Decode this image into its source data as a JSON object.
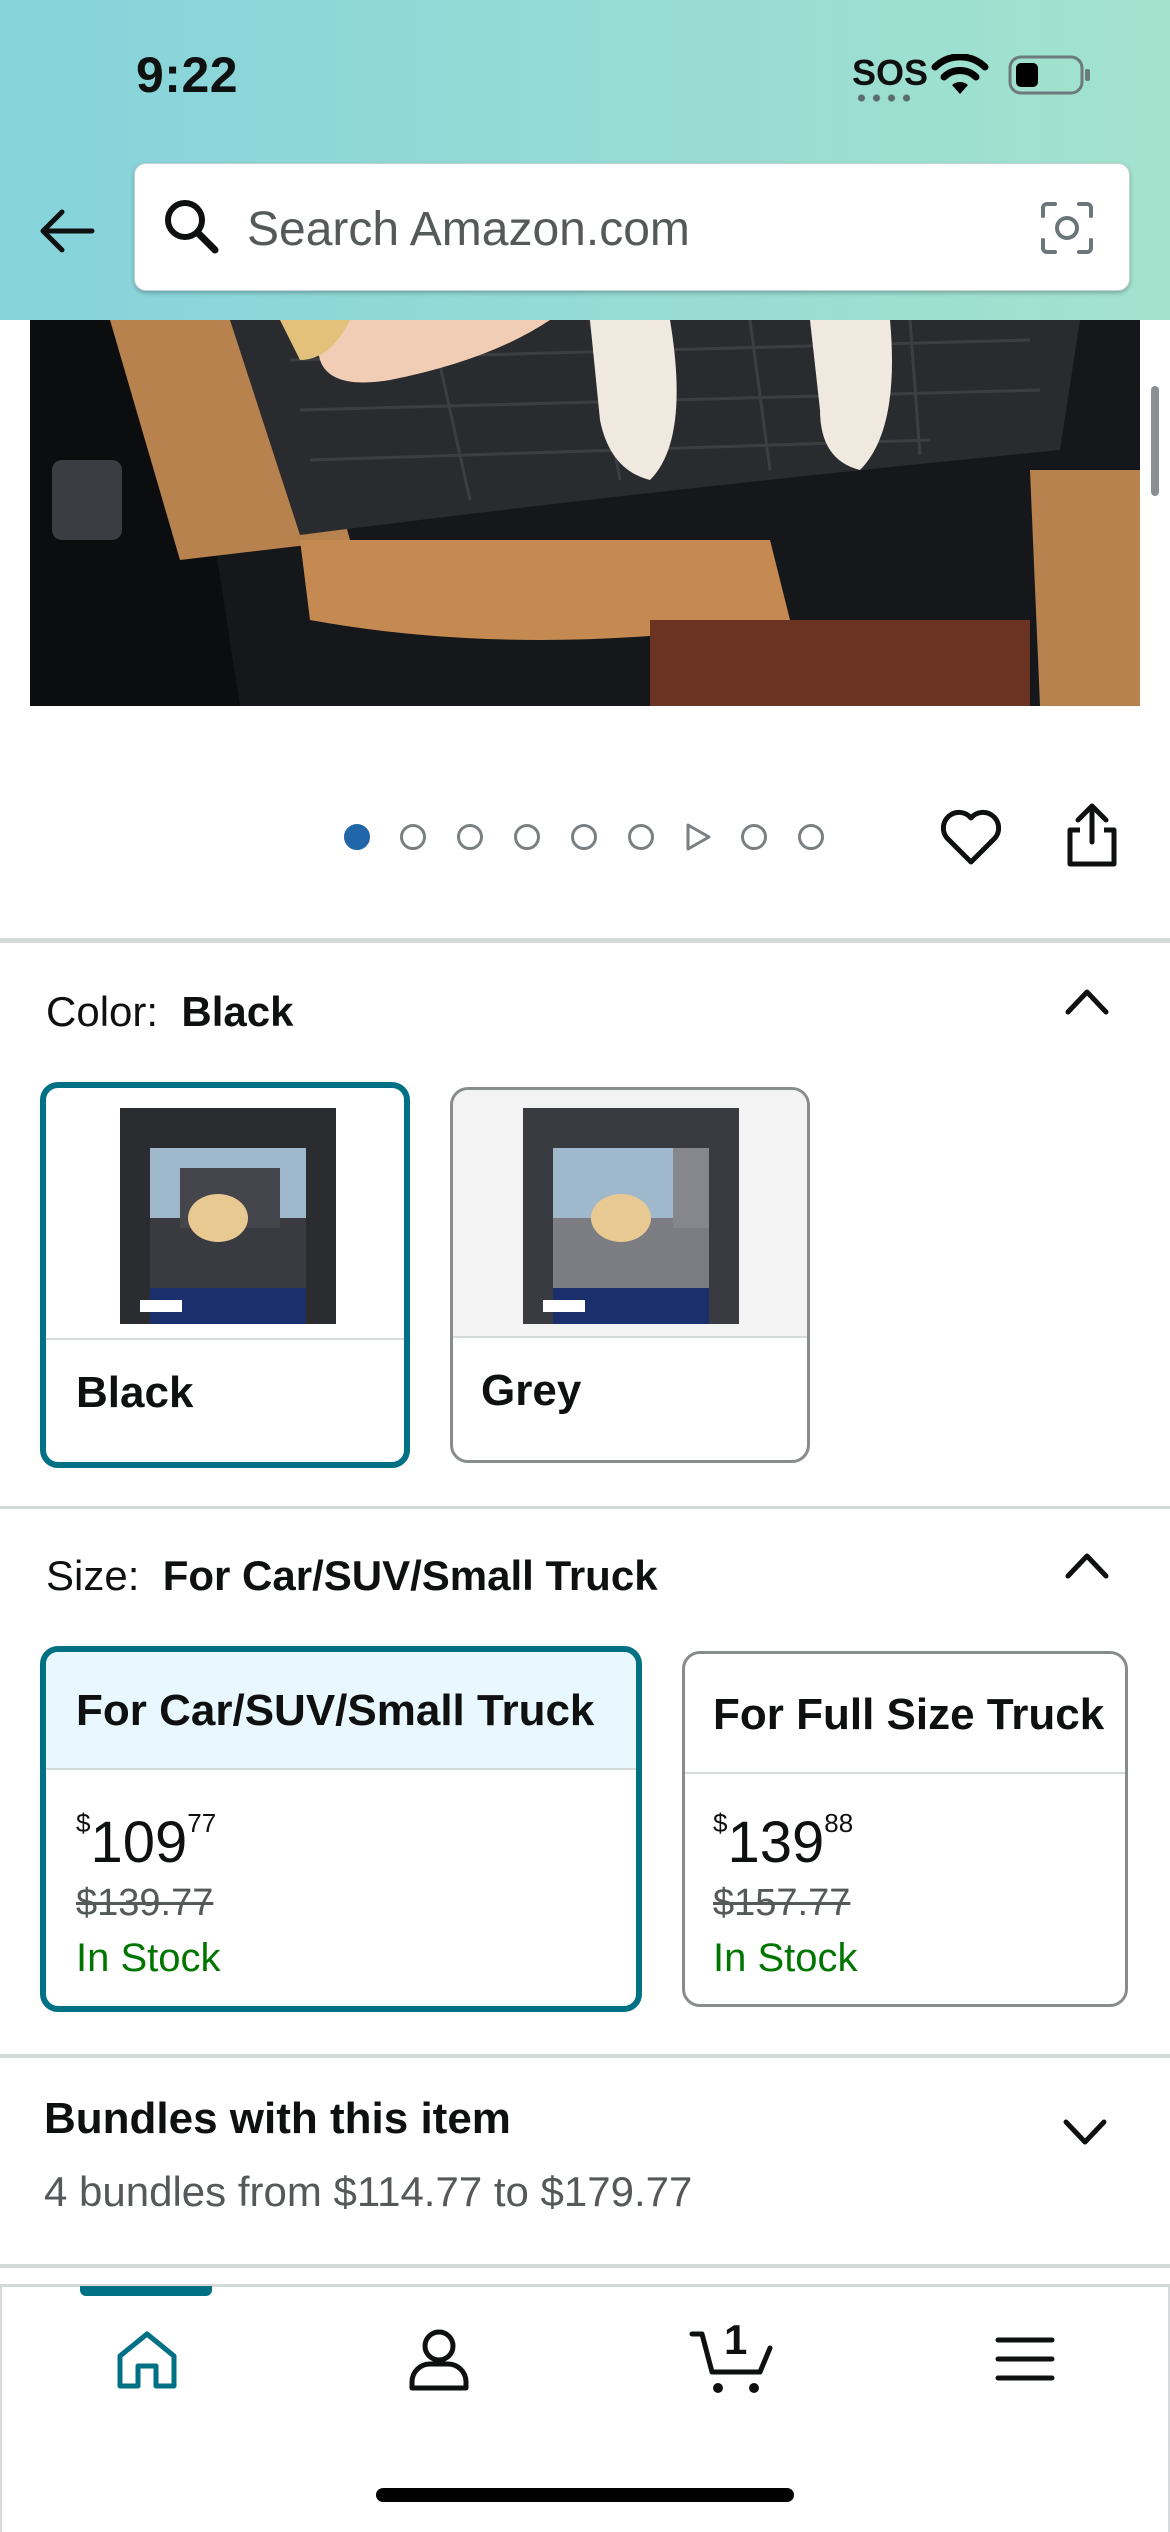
{
  "status_bar": {
    "time": "9:22",
    "sos": "SOS"
  },
  "search": {
    "placeholder": "Search Amazon.com"
  },
  "carousel": {
    "dot_count": 8,
    "active_index": 0
  },
  "color": {
    "label": "Color:",
    "selected_value": "Black",
    "options": [
      {
        "name": "Black",
        "selected": true
      },
      {
        "name": "Grey",
        "selected": false
      }
    ]
  },
  "size": {
    "label": "Size:",
    "selected_value": "For Car/SUV/Small Truck",
    "options": [
      {
        "name": "For Car/SUV/Small Truck",
        "currency": "$",
        "price_whole": "109",
        "price_fraction": "77",
        "list_price": "$139.77",
        "stock": "In Stock",
        "selected": true
      },
      {
        "name": "For Full Size Truck",
        "currency": "$",
        "price_whole": "139",
        "price_fraction": "88",
        "list_price": "$157.77",
        "stock": "In Stock",
        "selected": false
      }
    ]
  },
  "bundles": {
    "title": "Bundles with this item",
    "subtitle": "4 bundles from $114.77 to $179.77"
  },
  "bottom_nav": {
    "active": "home",
    "cart_count": "1",
    "items": [
      "home-icon",
      "account-icon",
      "cart-icon",
      "menu-icon"
    ]
  },
  "colors": {
    "accent": "#007185",
    "in_stock": "#007600",
    "active_dot": "#2166a8",
    "header_start": "#86d3dc",
    "header_end": "#a3e3cd"
  }
}
